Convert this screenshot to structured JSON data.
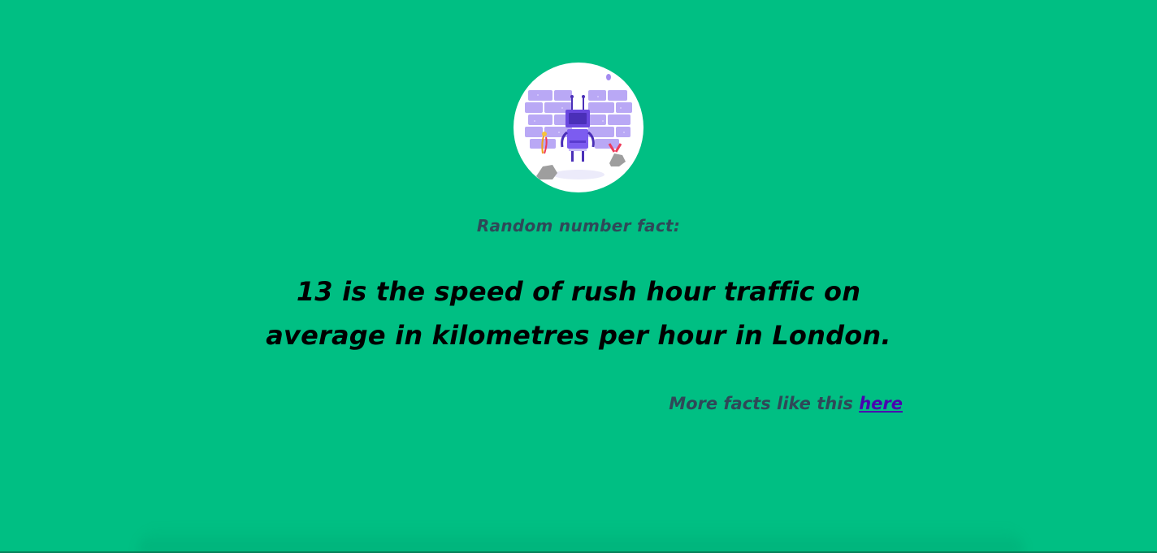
{
  "colors": {
    "background": "#00bf83",
    "label_text": "#2f4858",
    "fact_text": "#000000",
    "link": "#4a00b0"
  },
  "avatar": {
    "icon": "robot-illustration-icon"
  },
  "fact_label": "Random number fact:",
  "fact_text": "13 is the speed of rush hour traffic on average in kilometres per hour in London.",
  "more": {
    "prefix": "More facts like this ",
    "link_text": "here"
  }
}
